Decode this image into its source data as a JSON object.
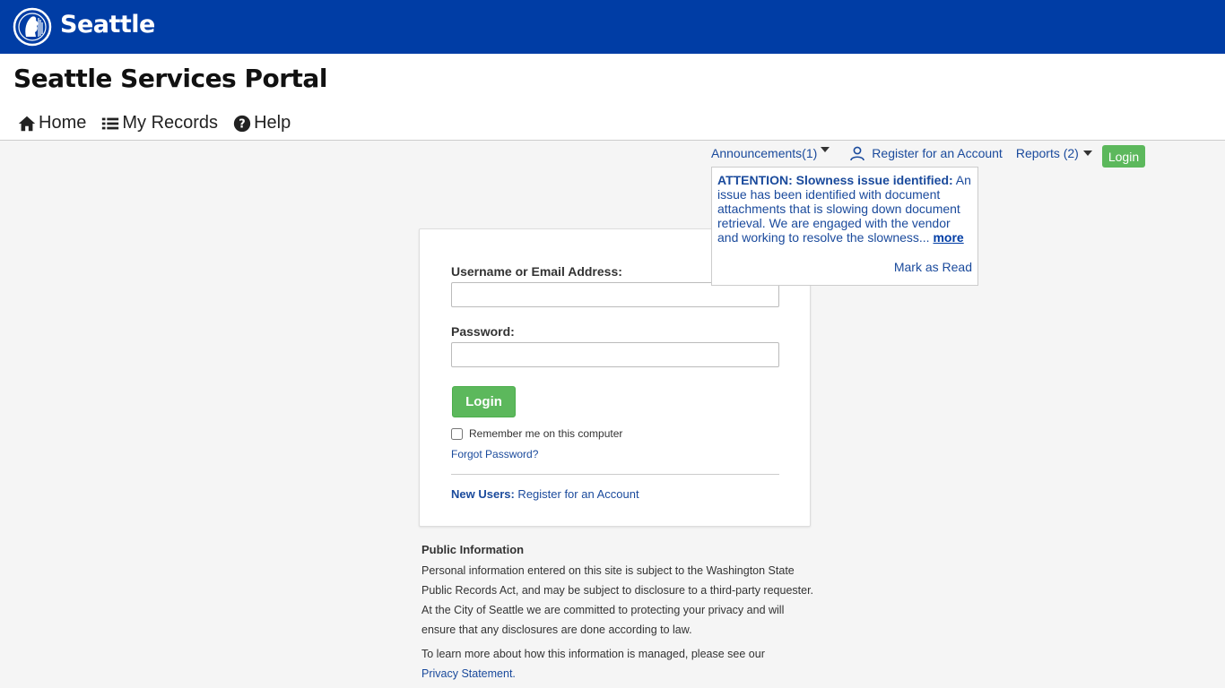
{
  "topbar": {
    "brand": "Seattle",
    "brand_color": "#003da5"
  },
  "header": {
    "title": "Seattle Services Portal",
    "nav": [
      {
        "label": "Home",
        "icon": "home-icon"
      },
      {
        "label": "My Records",
        "icon": "list-icon"
      },
      {
        "label": "Help",
        "icon": "question-circle-icon"
      }
    ]
  },
  "utility": {
    "announcements": "Announcements(1)",
    "register": "Register for an Account",
    "reports": "Reports (2)",
    "login": "Login"
  },
  "announcement": {
    "heading": "ATTENTION: Slowness issue identified:",
    "body": " An issue has been identified with document attachments that is slowing down document retrieval. We are engaged with the vendor and working to resolve the slowness... ",
    "more": "more",
    "mark_read": "Mark as Read"
  },
  "login_form": {
    "username_label": "Username or Email Address:",
    "username_value": "",
    "password_label": "Password:",
    "password_value": "",
    "login_button": "Login",
    "remember_label": "Remember me on this computer",
    "forgot": "Forgot Password?",
    "new_users_label": "New Users:",
    "new_users_link": " Register for an Account"
  },
  "public_info": {
    "heading": "Public Information",
    "para1": "Personal information entered on this site is subject to the Washington State Public Records Act, and may be subject to disclosure to a third-party requester. At the City of Seattle we are committed to protecting your privacy and will ensure that any disclosures are done according to law.",
    "para2": "To learn more about how this information is managed, please see our",
    "privacy_link": "Privacy Statement."
  },
  "colors": {
    "accent_green": "#5cb85c",
    "link_blue": "#1a4a9c"
  }
}
